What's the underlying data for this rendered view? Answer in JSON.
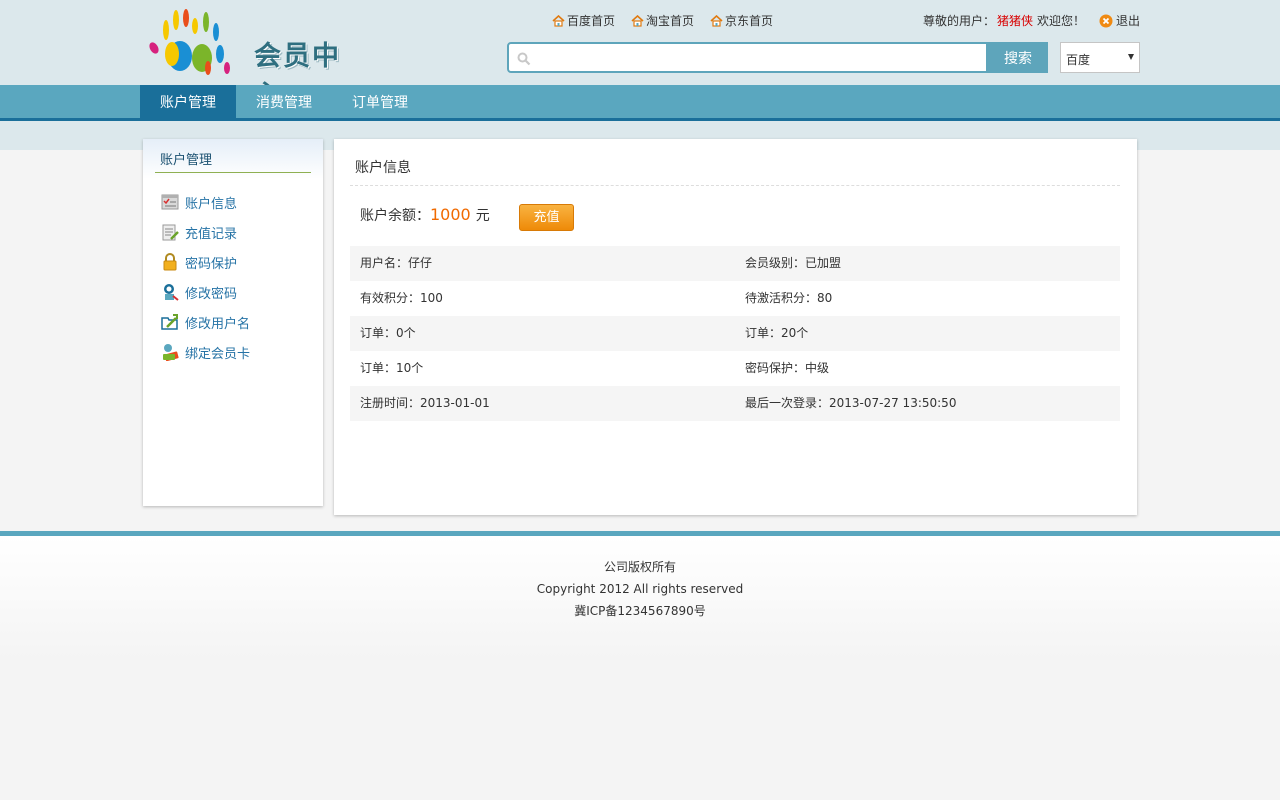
{
  "header": {
    "logo_text": "会员中心",
    "top_links": [
      {
        "label": "百度首页",
        "icon": "home-icon"
      },
      {
        "label": "淘宝首页",
        "icon": "home-icon"
      },
      {
        "label": "京东首页",
        "icon": "home-icon"
      }
    ],
    "greeting_prefix": "尊敬的用户：",
    "username": "猪猪侠",
    "greeting_suffix": "欢迎您！",
    "logout_label": "退出",
    "search": {
      "placeholder": "",
      "button_label": "搜索",
      "engine": "百度"
    }
  },
  "nav": {
    "tabs": [
      {
        "label": "账户管理",
        "active": true
      },
      {
        "label": "消费管理",
        "active": false
      },
      {
        "label": "订单管理",
        "active": false
      }
    ]
  },
  "sidebar": {
    "title": "账户管理",
    "items": [
      {
        "label": "账户信息",
        "icon": "account-info-icon"
      },
      {
        "label": "充值记录",
        "icon": "recharge-record-icon"
      },
      {
        "label": "密码保护",
        "icon": "lock-icon"
      },
      {
        "label": "修改密码",
        "icon": "change-password-icon"
      },
      {
        "label": "修改用户名",
        "icon": "edit-username-icon"
      },
      {
        "label": "绑定会员卡",
        "icon": "member-card-icon"
      }
    ]
  },
  "main": {
    "title": "账户信息",
    "balance_label": "账户余额：",
    "balance_amount": "1000",
    "balance_unit": "元",
    "recharge_label": "充值",
    "rows": [
      [
        "用户名：仔仔",
        "会员级别：已加盟"
      ],
      [
        "有效积分：100",
        "待激活积分：80"
      ],
      [
        "订单：0个",
        "订单：20个"
      ],
      [
        "订单：10个",
        "密码保护：中级"
      ],
      [
        "注册时间：2013-01-01",
        "最后一次登录：2013-07-27 13:50:50"
      ]
    ]
  },
  "footer": {
    "line1": "公司版权所有",
    "line2": "Copyright 2012 All rights reserved",
    "line3": "冀ICP备1234567890号"
  },
  "colors": {
    "nav": "#5aa7bf",
    "nav_active": "#1a6f9a",
    "balance": "#f06a00",
    "username": "#d80000"
  }
}
